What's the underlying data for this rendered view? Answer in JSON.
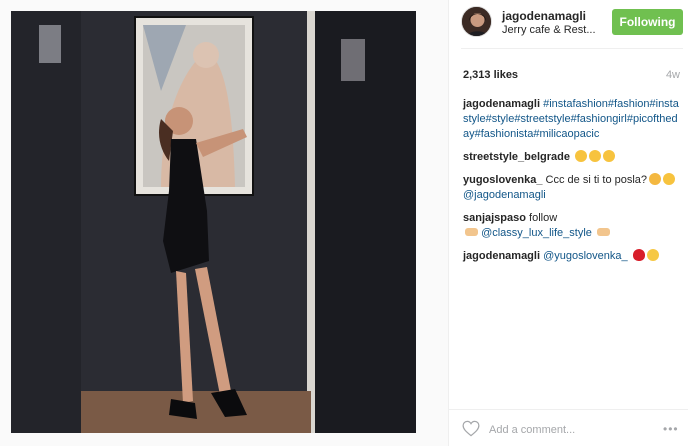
{
  "post": {
    "username": "jagodenamagli",
    "location": "Jerry cafe & Rest...",
    "follow_label": "Following",
    "likes": "2,313 likes",
    "age": "4w"
  },
  "caption": {
    "user": "jagodenamagli",
    "tags": "#instafashion#fashion#instastyle#style#streetstyle#fashiongirl#picoftheday#fashionista#milicaopacic"
  },
  "comments": [
    {
      "user": "streetstyle_belgrade",
      "text": "",
      "emoji": [
        "heart-eyes",
        "heart-eyes",
        "heart-eyes"
      ]
    },
    {
      "user": "yugoslovenka_",
      "text": "Ccc de si ti to posla?",
      "mention": "@jagodenamagli",
      "emoji": [
        "scream",
        "heart-eyes"
      ]
    },
    {
      "user": "sanjajspaso",
      "text": "follow",
      "mention": "@classy_lux_life_style",
      "emoji": [
        "point",
        "point"
      ]
    },
    {
      "user": "jagodenamagli",
      "text": "",
      "mention": "@yugoslovenka_",
      "emoji": [
        "kiss",
        "joy"
      ]
    }
  ],
  "composer": {
    "placeholder": "Add a comment...",
    "more": "•••"
  },
  "icons": {
    "like": "heart-outline-icon",
    "more": "more-options-icon"
  },
  "colors": {
    "follow_bg": "#70c050",
    "hashtag": "#125688",
    "muted": "#a5a7aa"
  }
}
